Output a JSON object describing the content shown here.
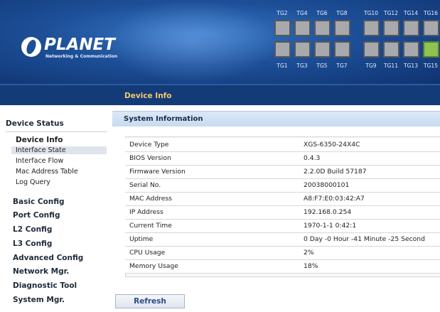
{
  "brand": {
    "name": "PLANET",
    "tagline": "Networking & Communication"
  },
  "ports": {
    "top_labels": [
      "TG2",
      "TG4",
      "TG6",
      "TG8",
      "TG10",
      "TG12",
      "TG14",
      "TG16"
    ],
    "bottom_labels": [
      "TG1",
      "TG3",
      "TG5",
      "TG7",
      "TG9",
      "TG11",
      "TG13",
      "TG15"
    ],
    "active_port": "TG15"
  },
  "titlebar": {
    "title": "Device Info"
  },
  "sidebar": {
    "status_head": "Device Status",
    "sub_items": [
      "Device Info",
      "Interface State",
      "Interface Flow",
      "Mac Address Table",
      "Log Query"
    ],
    "menus": [
      "Basic Config",
      "Port Config",
      "L2 Config",
      "L3 Config",
      "Advanced Config",
      "Network Mgr.",
      "Diagnostic Tool",
      "System Mgr."
    ]
  },
  "panel": {
    "title": "System Information",
    "rows": [
      [
        "Device Type",
        "XGS-6350-24X4C"
      ],
      [
        "BIOS Version",
        "0.4.3"
      ],
      [
        "Firmware Version",
        "2.2.0D Build 57187"
      ],
      [
        "Serial No.",
        "20038000101"
      ],
      [
        "MAC Address",
        "A8:F7:E0:03:42:A7"
      ],
      [
        "IP Address",
        "192.168.0.254"
      ],
      [
        "Current Time",
        "1970-1-1 0:42:1"
      ],
      [
        "Uptime",
        "0 Day -0 Hour -41 Minute -25 Second"
      ],
      [
        "CPU Usage",
        "2%"
      ],
      [
        "Memory Usage",
        "18%"
      ]
    ],
    "refresh_label": "Refresh"
  },
  "colors": {
    "header_blue": "#1d4f98",
    "titlebar": "#133b78",
    "title_text": "#f5c86a",
    "port_gray": "#a7a9ac",
    "port_active": "#8fc24f"
  }
}
